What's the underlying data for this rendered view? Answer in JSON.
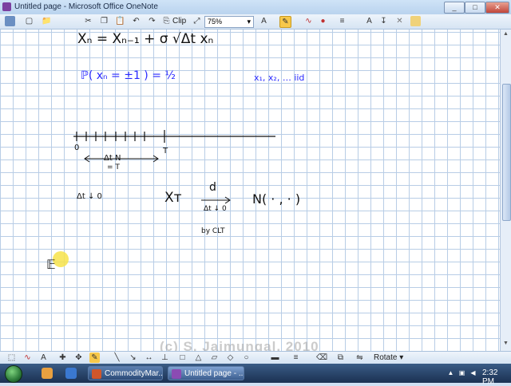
{
  "window": {
    "title": "Untitled page - Microsoft Office OneNote",
    "minimize": "_",
    "maximize": "□",
    "close": "✕"
  },
  "toolbar": {
    "clip_label": "Clip",
    "zoom": "75%",
    "icons": [
      "new-icon",
      "open-icon",
      "cut-icon",
      "copy-icon",
      "paste-icon",
      "undo-icon",
      "redo-icon",
      "clip-icon",
      "pen-icon",
      "highlighter-icon",
      "eraser-icon",
      "color-icon",
      "lasso-icon",
      "text-icon",
      "close-toolbar-icon"
    ]
  },
  "ink": {
    "eq1": "Xₙ  =  Xₙ₋₁  +  σ √Δt  xₙ",
    "eq2": "ℙ( xₙ = ±1 ) = ½",
    "iid": "x₁, x₂, …  iid",
    "label_zero": "0",
    "label_T": "T",
    "dtN": "Δt N",
    "eqT": "= T",
    "dt_down": "Δt ↓ 0",
    "XT": "Xᴛ",
    "d": "d",
    "dt_down2": "Δt ↓ 0",
    "normal": "N( ·  ,  · )",
    "by_clt": "by CLT",
    "E": "𝔼"
  },
  "ink_colors": {
    "blue": "#2a2aff",
    "black": "#111111"
  },
  "drawbar": {
    "rotate_label": "Rotate"
  },
  "watermark": "(c) S. Jaimungal, 2010",
  "taskbar": {
    "tasks": [
      {
        "label": "CommodityMar...",
        "icon": "powerpoint-icon"
      },
      {
        "label": "Untitled page - ...",
        "icon": "onenote-icon"
      }
    ],
    "clock": "2:32 PM"
  }
}
